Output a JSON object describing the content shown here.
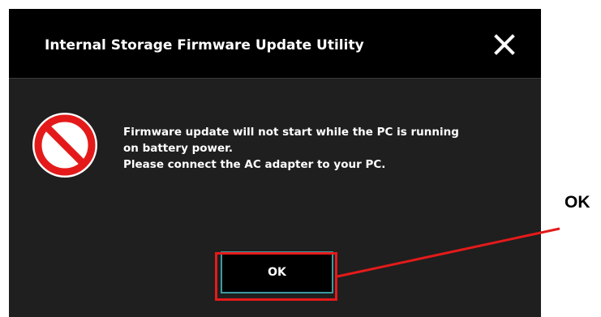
{
  "dialog": {
    "title": "Internal Storage Firmware Update Utility",
    "close_icon": "close-icon",
    "status_icon": "prohibited-icon",
    "message_lines": [
      "Firmware update will not start while the PC is running",
      "on battery power.",
      "Please connect the AC adapter to your PC."
    ],
    "ok_label": "OK"
  },
  "annotation": {
    "label": "OK",
    "highlight_color": "#e41a1a"
  },
  "colors": {
    "titlebar_bg": "#000000",
    "dialog_bg": "#1f1f1f",
    "button_border": "#3b9aa2",
    "icon_red": "#e41a1a"
  }
}
